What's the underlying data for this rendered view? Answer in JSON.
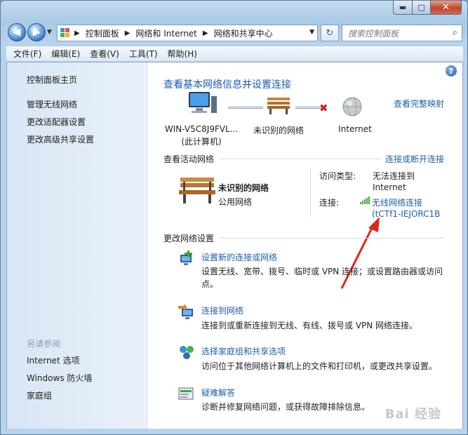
{
  "window": {
    "minimize_label": "▬",
    "maximize_label": "□",
    "close_label": "✕"
  },
  "nav": {
    "breadcrumbs": [
      "控制面板",
      "网络和 Internet",
      "网络和共享中心"
    ],
    "search_placeholder": "搜索控制面板"
  },
  "menu": [
    "文件(F)",
    "编辑(E)",
    "查看(V)",
    "工具(T)",
    "帮助(H)"
  ],
  "sidebar": {
    "items": [
      "控制面板主页",
      "管理无线网络",
      "更改适配器设置",
      "更改高级共享设置"
    ],
    "see_also_title": "另请参阅",
    "see_also": [
      "Internet 选项",
      "Windows 防火墙",
      "家庭组"
    ]
  },
  "main": {
    "title": "查看基本网络信息并设置连接",
    "full_map_link": "查看完整映射",
    "map": {
      "computer_line1": "WIN-V5C8J9FVL...",
      "computer_line2": "(此计算机)",
      "network": "未识别的网络",
      "internet": "Internet"
    },
    "active_networks": {
      "heading": "查看活动网络",
      "connect_link": "连接或断开连接",
      "network_name": "未识别的网络",
      "network_type": "公用网络",
      "access_type_label": "访问类型:",
      "access_type_value_line1": "无法连接到",
      "access_type_value_line2": "Internet",
      "connection_label": "连接:",
      "connection_value_line1": "无线网络连接",
      "connection_value_line2": "(tCTf1-IEJORC1B"
    },
    "change_settings": {
      "heading": "更改网络设置",
      "tasks": [
        {
          "title": "设置新的连接或网络",
          "desc_line1": "设置无线、宽带、拨号、临时或 VPN 连接；或设置路由器或访问",
          "desc_line2": "点。"
        },
        {
          "title": "连接到网络",
          "desc_line1": "连接到或重新连接到无线、有线、拨号或 VPN 网络连接。",
          "desc_line2": ""
        },
        {
          "title": "选择家庭组和共享选项",
          "desc_line1": "访问位于其他网络计算机上的文件和打印机，或更改共享设置。",
          "desc_line2": ""
        },
        {
          "title": "疑难解答",
          "desc_line1": "诊断并修复网络问题，或获得故障排除信息。",
          "desc_line2": ""
        }
      ]
    }
  },
  "watermark": "Bai 经验"
}
